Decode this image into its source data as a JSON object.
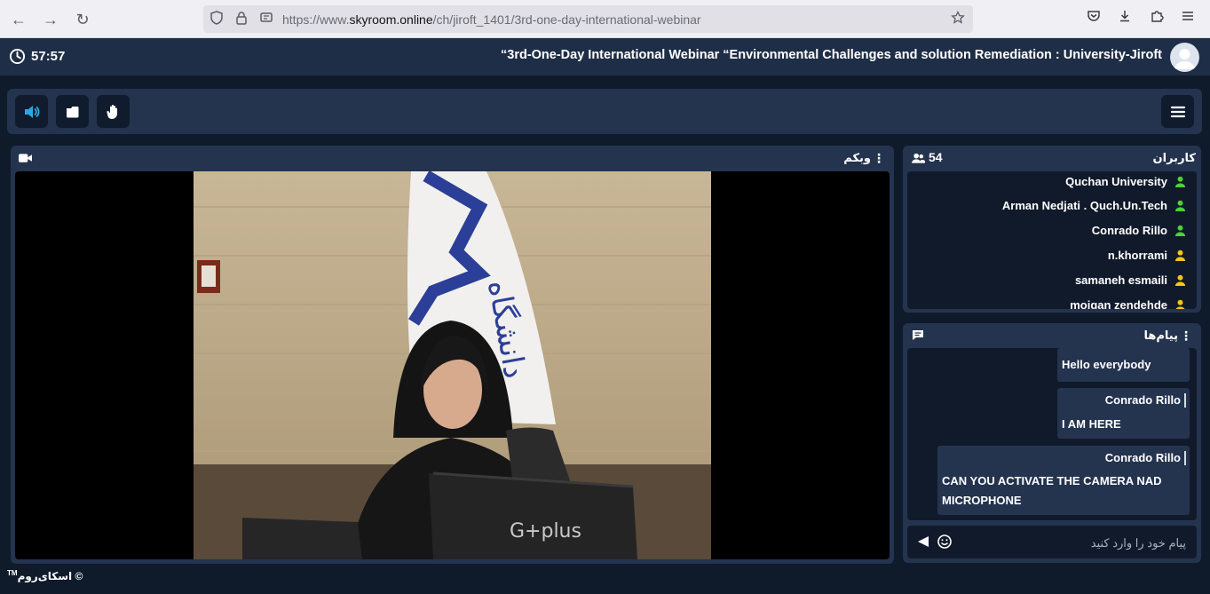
{
  "browser": {
    "url_prefix": "https://www.",
    "url_host": "skyroom.online",
    "url_path": "/ch/jiroft_1401/3rd-one-day-international-webinar"
  },
  "header": {
    "timer": "57:57",
    "title": "“3rd-One-Day International Webinar “Environmental Challenges and solution Remediation : University-Jiroft"
  },
  "webcam": {
    "title": "وبکم",
    "screen_text": "G+plus"
  },
  "users": {
    "title": "کاربران",
    "count": "54",
    "items": [
      {
        "name": "Quchan University",
        "status_color": "#4cd137"
      },
      {
        "name": "Arman Nedjati . Quch.Un.Tech",
        "status_color": "#4cd137"
      },
      {
        "name": "Conrado Rillo",
        "status_color": "#4cd137"
      },
      {
        "name": "n.khorrami",
        "status_color": "#f5c518"
      },
      {
        "name": "samaneh esmaili",
        "status_color": "#f5c518"
      },
      {
        "name": "mojgan zendehde",
        "status_color": "#f5c518"
      }
    ]
  },
  "chat": {
    "title": "پیام‌ها",
    "messages": [
      {
        "sender": "",
        "text": "Hello everybody"
      },
      {
        "sender": "Conrado Rillo",
        "text": "I AM HERE"
      },
      {
        "sender": "Conrado Rillo",
        "text": "CAN YOU ACTIVATE THE CAMERA NAD MICROPHONE"
      }
    ],
    "input_placeholder": "پیام خود را وارد کنید"
  },
  "footer": {
    "brand": "اسکای‌روم",
    "trademark": "TM"
  },
  "colors": {
    "accent": "#2aa7e0",
    "panel": "#24344f",
    "background": "#0f1a2b"
  }
}
